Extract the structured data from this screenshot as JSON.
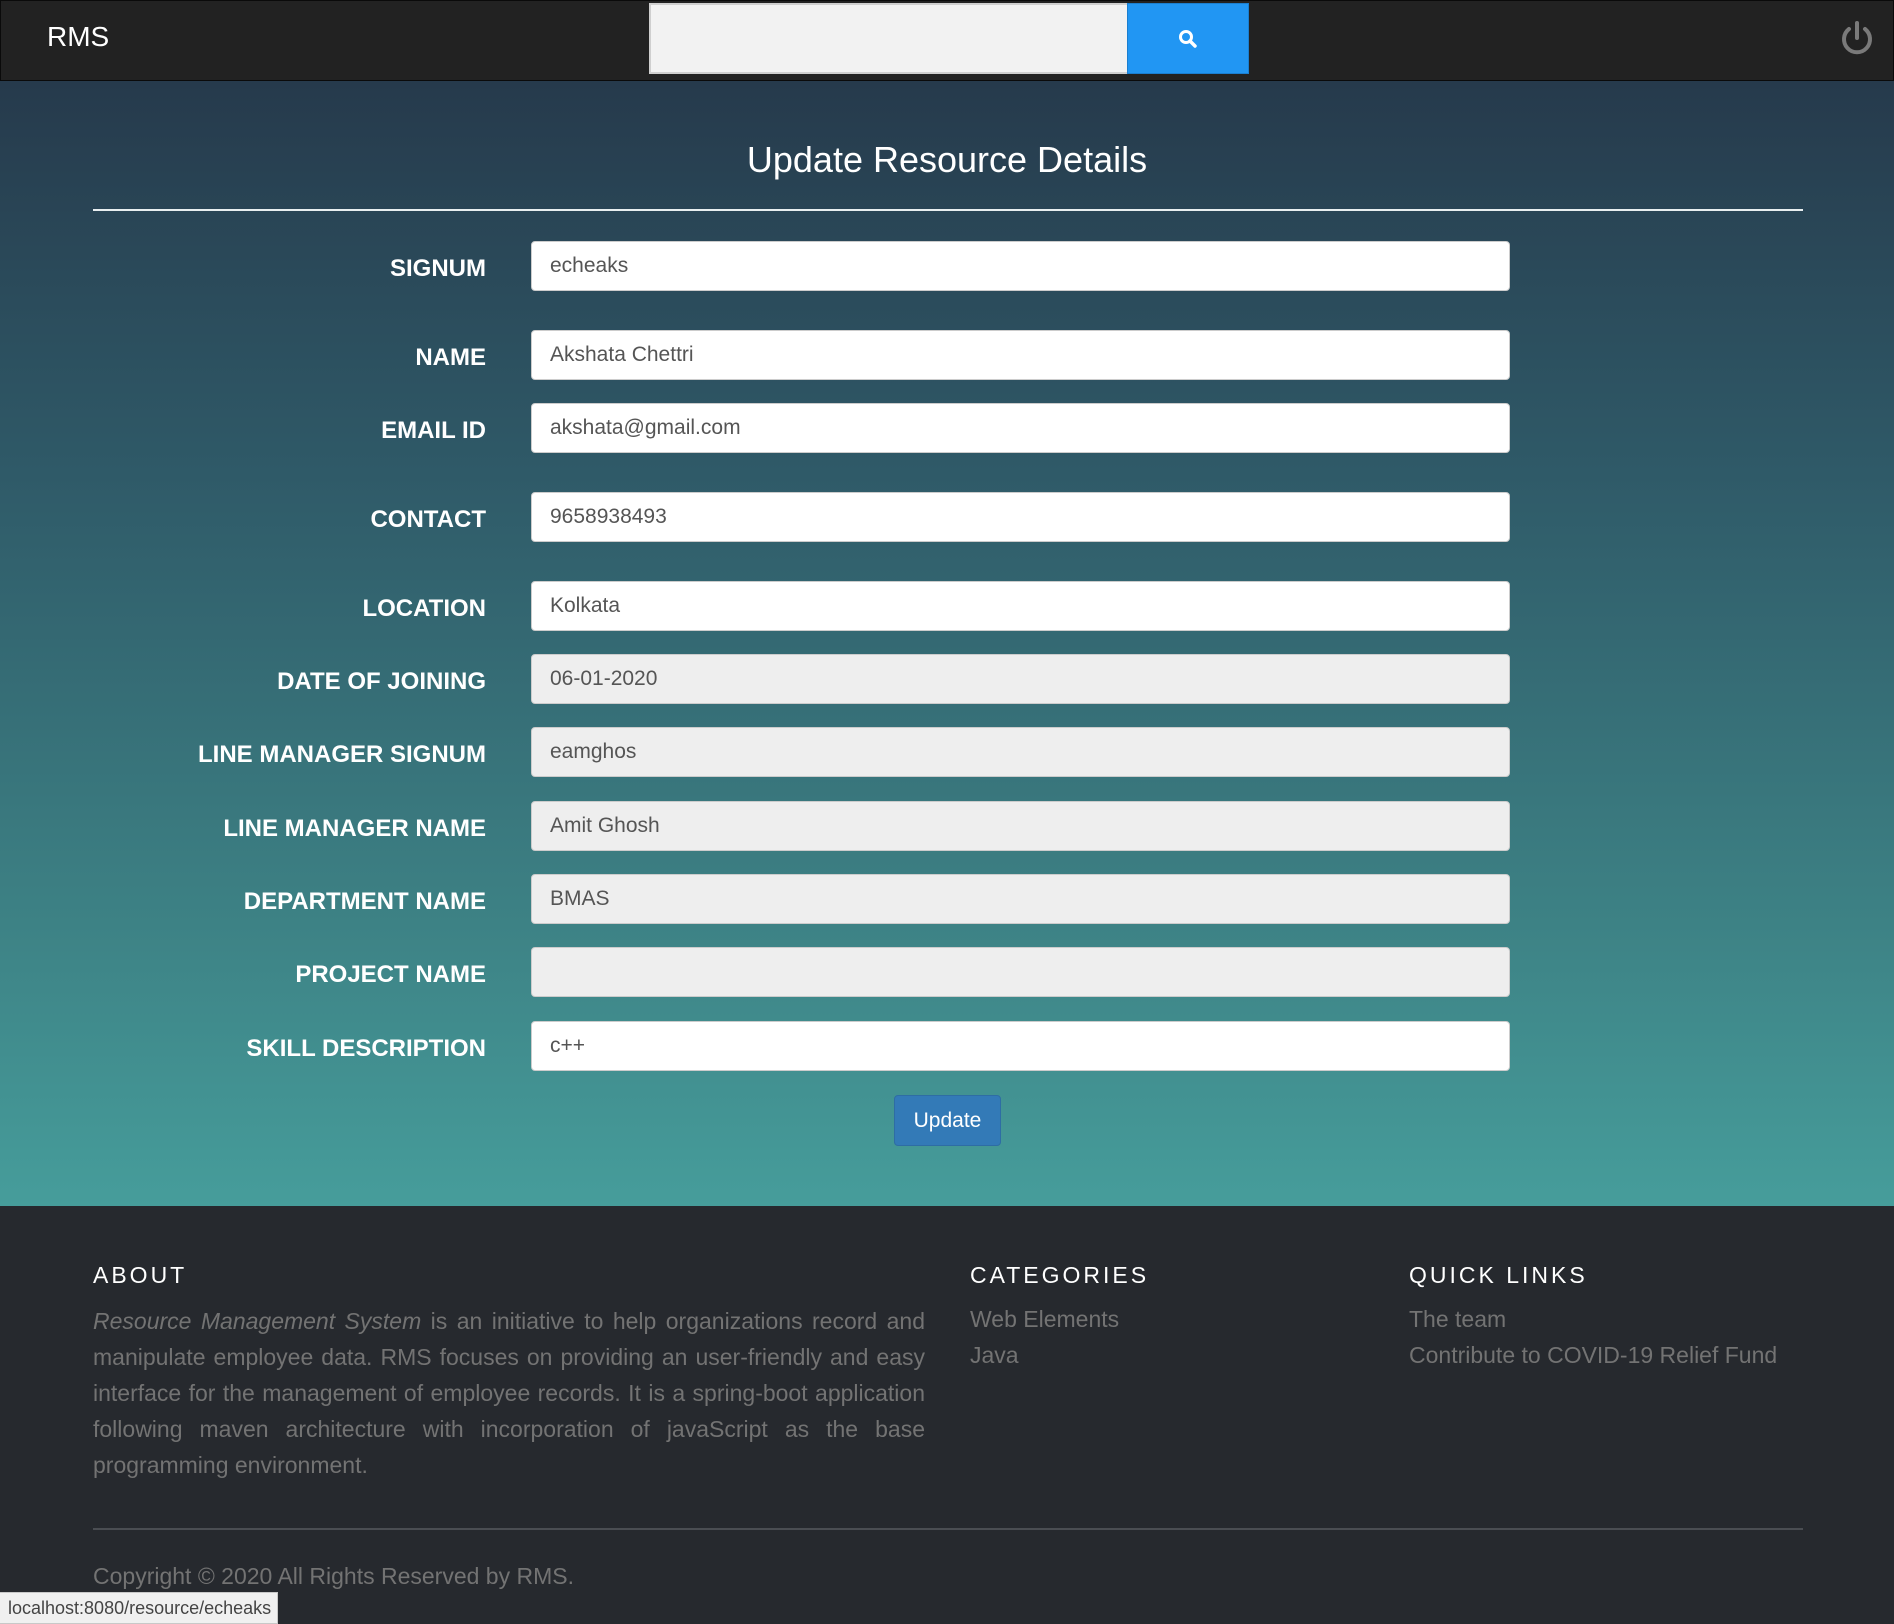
{
  "navbar": {
    "brand": "RMS",
    "search_placeholder": "",
    "search_icon": "search-icon",
    "power_icon": "power-icon"
  },
  "form": {
    "title": "Update Resource Details",
    "fields": [
      {
        "label": "SIGNUM",
        "value": "echeaks",
        "readonly": false
      },
      {
        "label": "NAME",
        "value": "Akshata Chettri",
        "readonly": false
      },
      {
        "label": "EMAIL ID",
        "value": "akshata@gmail.com",
        "readonly": false
      },
      {
        "label": "CONTACT",
        "value": "9658938493",
        "readonly": false
      },
      {
        "label": "LOCATION",
        "value": "Kolkata",
        "readonly": false
      },
      {
        "label": "DATE OF JOINING",
        "value": "06-01-2020",
        "readonly": true
      },
      {
        "label": "LINE MANAGER SIGNUM",
        "value": "eamghos",
        "readonly": true
      },
      {
        "label": "LINE MANAGER NAME",
        "value": "Amit Ghosh",
        "readonly": true
      },
      {
        "label": "DEPARTMENT NAME",
        "value": "BMAS",
        "readonly": true
      },
      {
        "label": "PROJECT NAME",
        "value": "",
        "readonly": true
      },
      {
        "label": "SKILL DESCRIPTION",
        "value": "c++",
        "readonly": false
      }
    ],
    "submit_label": "Update"
  },
  "footer": {
    "about": {
      "heading": "ABOUT",
      "emphasis": "Resource Management System",
      "text": " is an initiative to help organizations record and manipulate employee data. RMS focuses on providing an user-friendly and easy interface for the management of employee records. It is a spring-boot application following maven architecture with incorporation of javaScript as the base programming environment."
    },
    "categories": {
      "heading": "CATEGORIES",
      "links": [
        "Web Elements",
        "Java"
      ]
    },
    "quick_links": {
      "heading": "QUICK LINKS",
      "links": [
        "The team",
        "Contribute to COVID-19 Relief Fund"
      ]
    },
    "copyright": "Copyright © 2020 All Rights Reserved by RMS."
  },
  "status_bar": {
    "url": "localhost:8080/resource/echeaks"
  },
  "colors": {
    "accent": "#2196f3",
    "button": "#337ab7",
    "navbar": "#222222",
    "footer": "#26292e"
  }
}
